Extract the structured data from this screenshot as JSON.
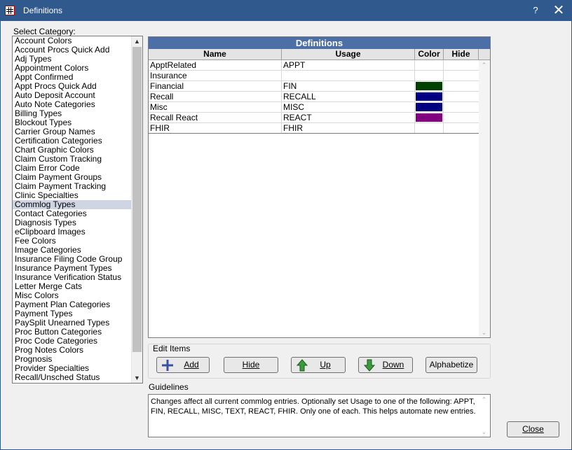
{
  "window": {
    "title": "Definitions",
    "help_label": "?",
    "close_glyph": "✕"
  },
  "category": {
    "label": "Select Category:",
    "items": [
      "Account Colors",
      "Account Procs Quick Add",
      "Adj Types",
      "Appointment Colors",
      "Appt Confirmed",
      "Appt Procs Quick Add",
      "Auto Deposit Account",
      "Auto Note Categories",
      "Billing Types",
      "Blockout Types",
      "Carrier Group Names",
      "Certification Categories",
      "Chart Graphic Colors",
      "Claim Custom Tracking",
      "Claim Error Code",
      "Claim Payment Groups",
      "Claim Payment Tracking",
      "Clinic Specialties",
      "Commlog Types",
      "Contact Categories",
      "Diagnosis Types",
      "eClipboard Images",
      "Fee Colors",
      "Image Categories",
      "Insurance Filing Code Group",
      "Insurance Payment Types",
      "Insurance Verification Status",
      "Letter Merge Cats",
      "Misc Colors",
      "Payment Plan Categories",
      "Payment Types",
      "PaySplit Unearned Types",
      "Proc Button Categories",
      "Proc Code Categories",
      "Prog Notes Colors",
      "Prognosis",
      "Provider Specialties",
      "Recall/Unsched Status"
    ],
    "selected": "Commlog Types"
  },
  "definitions": {
    "title": "Definitions",
    "columns": [
      "Name",
      "Usage",
      "Color",
      "Hide"
    ],
    "rows": [
      {
        "name": "ApptRelated",
        "usage": "APPT",
        "color": "",
        "hide": ""
      },
      {
        "name": "Insurance",
        "usage": "",
        "color": "",
        "hide": ""
      },
      {
        "name": "Financial",
        "usage": "FIN",
        "color": "#004000",
        "hide": ""
      },
      {
        "name": "Recall",
        "usage": "RECALL",
        "color": "#000080",
        "hide": ""
      },
      {
        "name": "Misc",
        "usage": "MISC",
        "color": "#000080",
        "hide": ""
      },
      {
        "name": "Recall React",
        "usage": "REACT",
        "color": "#800080",
        "hide": ""
      },
      {
        "name": "FHIR",
        "usage": "FHIR",
        "color": "",
        "hide": ""
      }
    ]
  },
  "edit_items": {
    "label": "Edit Items",
    "add_label": "Add",
    "hide_label": "Hide",
    "up_label": "Up",
    "down_label": "Down",
    "alphabetize_label": "Alphabetize"
  },
  "guidelines": {
    "label": "Guidelines",
    "text": "Changes affect all current commlog entries.  Optionally set Usage to one of the following: APPT, FIN, RECALL, MISC, TEXT, REACT, FHIR. Only one of each. This helps automate new entries."
  },
  "close_label": "Close"
}
